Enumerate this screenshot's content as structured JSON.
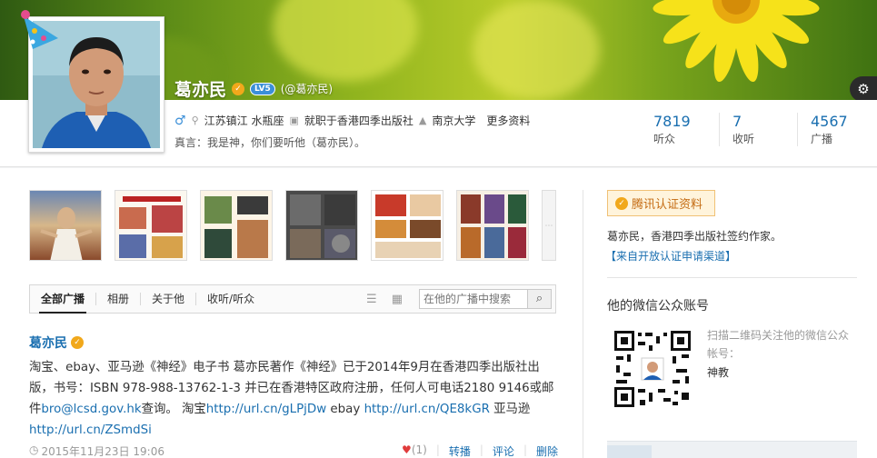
{
  "profile": {
    "name": "葛亦民",
    "level_badge": "LV5",
    "handle": "(@葛亦民)",
    "location": "江苏镇江 水瓶座",
    "job": "就职于香港四季出版社",
    "school": "南京大学",
    "more_link": "更多资料",
    "motto": "真言：我是神，你们要听他（葛亦民）。",
    "stats": [
      {
        "value": "7819",
        "label": "听众"
      },
      {
        "value": "7",
        "label": "收听"
      },
      {
        "value": "4567",
        "label": "广播"
      }
    ]
  },
  "tabs": {
    "items": [
      "全部广播",
      "相册",
      "关于他",
      "收听/听众"
    ],
    "search_placeholder": "在他的广播中搜索"
  },
  "post": {
    "author": "葛亦民",
    "text_1": "淘宝、ebay、亚马逊《神经》电子书 葛亦民著作《神经》已于2014年9月在香港四季出版社出版，书号：ISBN 978-988-13762-1-3 并已在香港特区政府注册，任何人可电话2180 9146或邮件",
    "email": "bro@lcsd.gov.hk",
    "text_2": "查询。 淘宝",
    "link_taobao": "http://url.cn/gLPjDw",
    "text_3": " ebay ",
    "link_ebay": "http://url.cn/QE8kGR",
    "text_4": " 亚马逊 ",
    "link_amazon": "http://url.cn/ZSmdSi",
    "timestamp": "2015年11月23日 19:06",
    "likes": "(1)",
    "action_rebroadcast": "转播",
    "action_comment": "评论",
    "action_delete": "删除"
  },
  "sidebar": {
    "verify_button": "腾讯认证资料",
    "verify_desc": "葛亦民，香港四季出版社签约作家。",
    "verify_link": "【来自开放认证申请渠道】",
    "wechat_title": "他的微信公众账号",
    "wechat_desc": "扫描二维码关注他的微信公众帐号：",
    "wechat_name": "神教"
  },
  "colors": {
    "link": "#1a6fb0",
    "verify_bg": "#fff4dc",
    "verify_text": "#c46b12",
    "badge_gold": "#f1a81b"
  }
}
